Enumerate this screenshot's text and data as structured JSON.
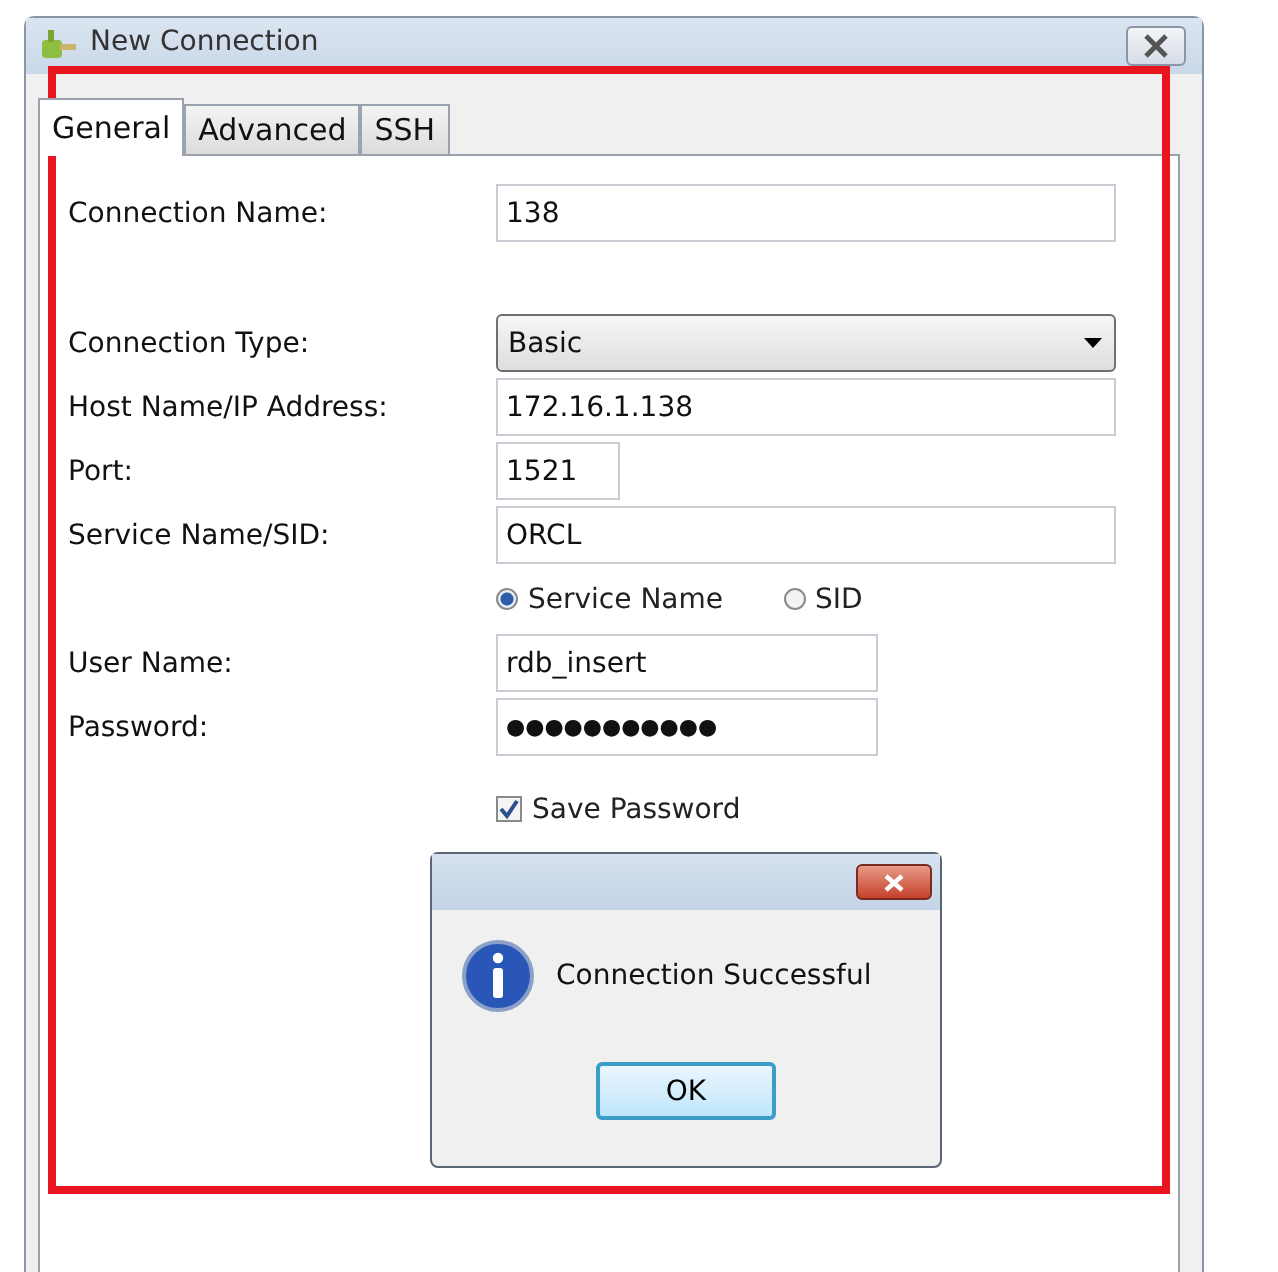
{
  "window": {
    "title": "New Connection"
  },
  "tabs": [
    {
      "label": "General",
      "selected": true
    },
    {
      "label": "Advanced",
      "selected": false
    },
    {
      "label": "SSH",
      "selected": false
    }
  ],
  "fields": [
    {
      "kind": "text",
      "label": "Connection Name:",
      "value": "138"
    },
    {
      "kind": "select",
      "label": "Connection Type:",
      "value": "Basic"
    },
    {
      "kind": "text",
      "label": "Host Name/IP Address:",
      "value": "172.16.1.138"
    },
    {
      "kind": "text",
      "label": "Port:",
      "value": "1521"
    },
    {
      "kind": "text",
      "label": "Service Name/SID:",
      "value": "ORCL"
    },
    {
      "kind": "radios",
      "options": [
        {
          "label": "Service Name",
          "selected": true
        },
        {
          "label": "SID",
          "selected": false
        }
      ]
    },
    {
      "kind": "text",
      "label": "User Name:",
      "value": "rdb_insert"
    },
    {
      "kind": "password",
      "label": "Password:",
      "value": "●●●●●●●●●●●"
    },
    {
      "kind": "checkbox",
      "label": "Save Password",
      "checked": true
    }
  ],
  "message_box": {
    "message": "Connection Successful",
    "buttons": [
      "OK"
    ]
  }
}
